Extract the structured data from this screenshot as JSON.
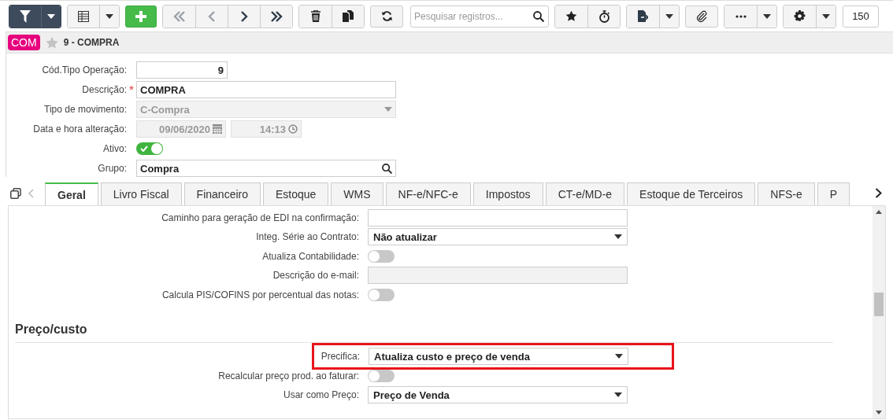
{
  "toolbar": {
    "search": {
      "placeholder": "Pesquisar registros..."
    },
    "page_size": "150"
  },
  "header": {
    "badge": "COM",
    "favorite": false,
    "title": "9 - COMPRA"
  },
  "form": [
    {
      "kind": "number",
      "label": "Cód.Tipo Operação:",
      "value": "9"
    },
    {
      "kind": "text",
      "label": "Descrição:",
      "value": "COMPRA",
      "required_mark": "*"
    },
    {
      "kind": "select",
      "label": "Tipo de movimento:",
      "value": "C-Compra",
      "disabled": true
    },
    {
      "kind": "datetime",
      "label": "Data e hora alteração:",
      "date": "09/06/2020",
      "time": "14:13",
      "disabled": true
    },
    {
      "kind": "toggle",
      "label": "Ativo:",
      "on": true
    },
    {
      "kind": "lookup",
      "label": "Grupo:",
      "value": "Compra"
    }
  ],
  "tabs": [
    {
      "label": "Geral",
      "selected": true
    },
    {
      "label": "Livro Fiscal",
      "selected": false
    },
    {
      "label": "Financeiro",
      "selected": false
    },
    {
      "label": "Estoque",
      "selected": false
    },
    {
      "label": "WMS",
      "selected": false
    },
    {
      "label": "NF-e/NFC-e",
      "selected": false
    },
    {
      "label": "Impostos",
      "selected": false
    },
    {
      "label": "CT-e/MD-e",
      "selected": false
    },
    {
      "label": "Estoque de Terceiros",
      "selected": false
    },
    {
      "label": "NFS-e",
      "selected": false
    },
    {
      "label": "P",
      "selected": false
    }
  ],
  "tab_rows": [
    {
      "kind": "text",
      "label": "Caminho para geração de EDI na confirmação:",
      "disabled": false
    },
    {
      "kind": "select",
      "label": "Integ. Série ao Contrato:",
      "value": "Não atualizar"
    },
    {
      "kind": "toggle",
      "label": "Atualiza Contabilidade:",
      "on": false
    },
    {
      "kind": "text",
      "label": "Descrição do e-mail:",
      "disabled": true
    },
    {
      "kind": "toggle",
      "label": "Calcula PIS/COFINS por percentual das notas:",
      "on": false
    }
  ],
  "section": {
    "title": "Preço/custo",
    "rows": [
      {
        "kind": "select",
        "label": "Precifica:",
        "value": "Atualiza custo e preço de venda",
        "highlighted": true
      },
      {
        "kind": "toggle",
        "label": "Recalcular preço prod. ao faturar:",
        "on": false
      },
      {
        "kind": "select",
        "label": "Usar como Preço:",
        "value": "Preço de Venda"
      }
    ]
  }
}
